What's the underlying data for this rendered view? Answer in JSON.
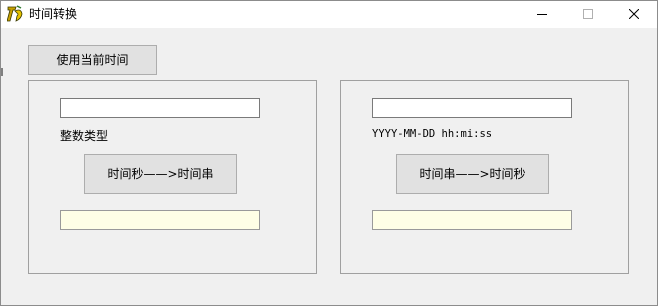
{
  "window": {
    "title": "时间转换"
  },
  "toolbar": {
    "now_button": "使用当前时间"
  },
  "left_panel": {
    "input_value": "",
    "type_label": "整数类型",
    "convert_button": "时间秒——>时间串",
    "result_value": ""
  },
  "right_panel": {
    "input_value": "",
    "format_label": "YYYY-MM-DD hh:mi:ss",
    "convert_button": "时间串——>时间秒",
    "result_value": ""
  },
  "icons": {
    "app": "app-icon",
    "minimize": "minimize-icon",
    "maximize": "maximize-icon",
    "close": "close-icon"
  },
  "colors": {
    "result_field_bg": "#ffffe6",
    "window_bg": "#f0f0f0",
    "button_bg": "#e1e1e1"
  }
}
